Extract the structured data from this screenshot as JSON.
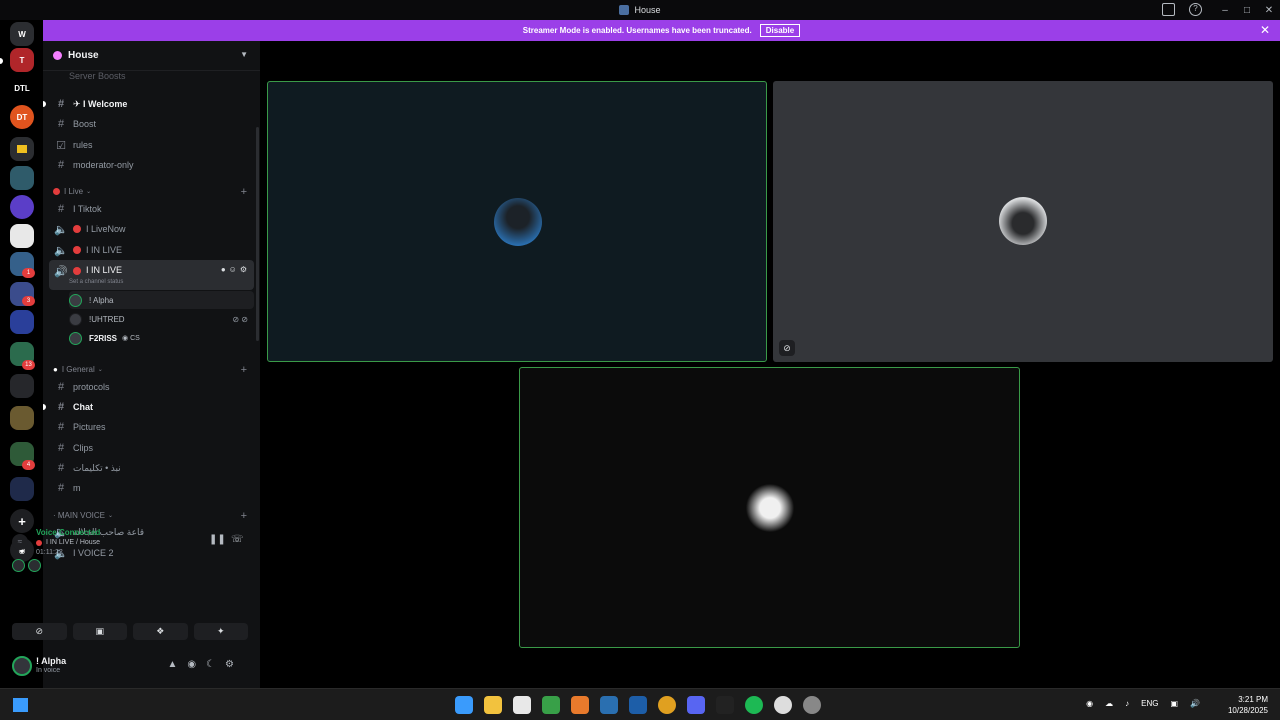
{
  "window": {
    "title": "House"
  },
  "banner": {
    "text": "Streamer Mode is enabled. Usernames have been truncated.",
    "disable_label": "Disable"
  },
  "rail": {
    "servers": [
      "W",
      "T",
      "DTL",
      "DT"
    ]
  },
  "guild": {
    "name": "House",
    "scroll_hint": "Server Boosts"
  },
  "channels": {
    "welcome": "✈ I Welcome",
    "boost": "Boost",
    "rules": "rules",
    "moderator": "moderator-only",
    "live_category": "I Live",
    "tiktok": "I Tiktok",
    "livenow": "I LiveNow",
    "inlive1": "I IN LIVE",
    "inlive2": "I IN LIVE",
    "channel_status": "Set a channel status",
    "general_category": "I General",
    "protocols": "protocols",
    "chat": "Chat",
    "pictures": "Pictures",
    "clips": "Clips",
    "arabic1": "نبذ • تكليمات",
    "m": "m",
    "main_voice_category": "· MAIN VOICE",
    "arabic2": "قاعة صاحب الجلالة",
    "voice2": "I VOICE 2"
  },
  "voice_users": [
    {
      "name": "! Alpha"
    },
    {
      "name": "!UHTRED"
    },
    {
      "name": "F2RISS",
      "tag": "CS"
    }
  ],
  "voice_panel": {
    "status": "Voice Connected",
    "location": "I IN LIVE / House",
    "timer": "01:11:22"
  },
  "user": {
    "name": "! Alpha",
    "status": "In voice"
  },
  "taskbar": {
    "lang": "ENG",
    "time": "3:21 PM",
    "date": "10/28/2025"
  },
  "colors": {
    "accent_banner": "#9b3fe8",
    "speaking_green": "#3a9a48",
    "live_red": "#e33d3d"
  }
}
